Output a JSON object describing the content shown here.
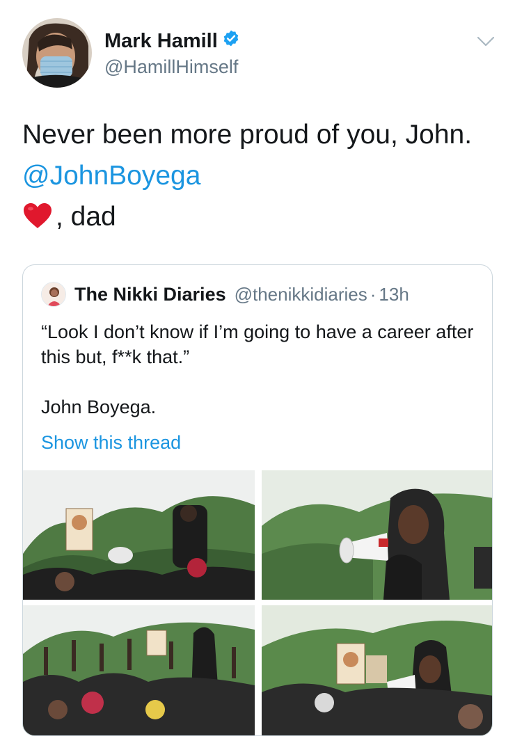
{
  "tweet": {
    "author": {
      "display_name": "Mark Hamill",
      "handle": "@HamillHimself",
      "verified": true,
      "verified_badge_color": "#1da1f2"
    },
    "text_line1": "Never been more proud of you, John.",
    "mention": "@JohnBoyega",
    "heart_icon": "red-heart-emoji",
    "sign_off": ", dad",
    "menu_icon": "chevron-down-icon"
  },
  "quoted_tweet": {
    "author_name": "The Nikki Diaries",
    "author_handle": "@thenikkidiaries",
    "separator": "·",
    "time": "13h",
    "text_line1": "“Look I don’t know if I’m going to have a career after this but, f**k that.”",
    "text_line2": "John Boyega.",
    "show_thread_label": "Show this thread",
    "photos": [
      {
        "label": "protest photo 1"
      },
      {
        "label": "protest photo 2"
      },
      {
        "label": "protest photo 3"
      },
      {
        "label": "protest photo 4"
      }
    ]
  },
  "colors": {
    "link": "#1b95e0",
    "secondary_text": "#657786",
    "primary_text": "#14171a",
    "border": "#ccd6dd"
  }
}
